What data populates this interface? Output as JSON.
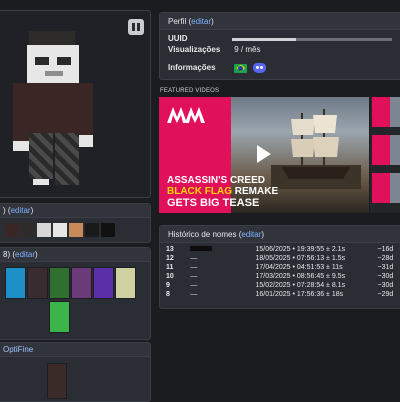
{
  "profile": {
    "title": "Perfil",
    "edit": "editar",
    "uuid_label": "UUID",
    "views_label": "Visualizações",
    "views_value": "9 / mês",
    "info_label": "Informações"
  },
  "featured": {
    "label": "FEATURED VIDEOS",
    "title_line1": "ASSASSIN'S CREED",
    "title_line2a": "BLACK FLAG",
    "title_line2b": "REMAKE",
    "title_line3": "GETS BIG TEASE",
    "channel": "MW"
  },
  "history": {
    "title": "Histórico de nomes",
    "edit": "editar",
    "rows": [
      {
        "num": "13",
        "name": "",
        "date": "15/06/2025 • 19:39:55 ± 2.1s",
        "ago": "~16d"
      },
      {
        "num": "12",
        "name": "—",
        "date": "18/05/2025 • 07:56:13 ± 1.5s",
        "ago": "~28d"
      },
      {
        "num": "11",
        "name": "—",
        "date": "17/04/2025 • 04:51:53 ± 11s",
        "ago": "~31d"
      },
      {
        "num": "10",
        "name": "—",
        "date": "17/03/2025 • 08:56:45 ± 9.5s",
        "ago": "~30d"
      },
      {
        "num": "9",
        "name": "—",
        "date": "15/02/2025 • 07:28:54 ± 8.1s",
        "ago": "~30d"
      },
      {
        "num": "8",
        "name": "—",
        "date": "16/01/2025 • 17:56:36 ± 18s",
        "ago": "~29d"
      }
    ]
  },
  "caps_card": {
    "title_suffix": ")",
    "edit": "editar"
  },
  "capes_card": {
    "title_suffix": "8)",
    "edit": "editar"
  },
  "optifine": {
    "title": "OptiFine"
  },
  "colors": {
    "accent": "#7fb2ff",
    "brand": "#e0105a",
    "card": "#2a2d33"
  }
}
